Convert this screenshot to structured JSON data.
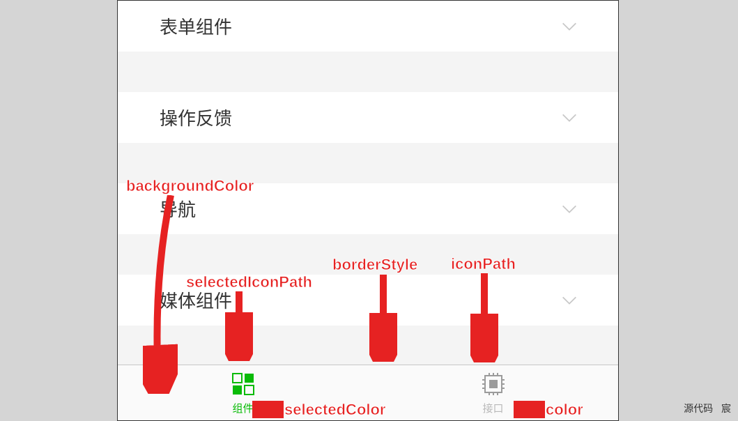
{
  "list": {
    "items": [
      {
        "label": "表单组件"
      },
      {
        "label": "操作反馈"
      },
      {
        "label": "导航"
      },
      {
        "label": "媒体组件"
      }
    ]
  },
  "tabbar": {
    "tabs": [
      {
        "label": "组件",
        "selected": true
      },
      {
        "label": "接口",
        "selected": false
      }
    ]
  },
  "annotations": {
    "backgroundColor": "backgroundColor",
    "selectedIconPath": "selectedIconPath",
    "borderStyle": "borderStyle",
    "iconPath": "iconPath",
    "selectedColor": "selectedColor",
    "color": "color"
  },
  "footer": {
    "source": "源代码",
    "author": "宸"
  }
}
